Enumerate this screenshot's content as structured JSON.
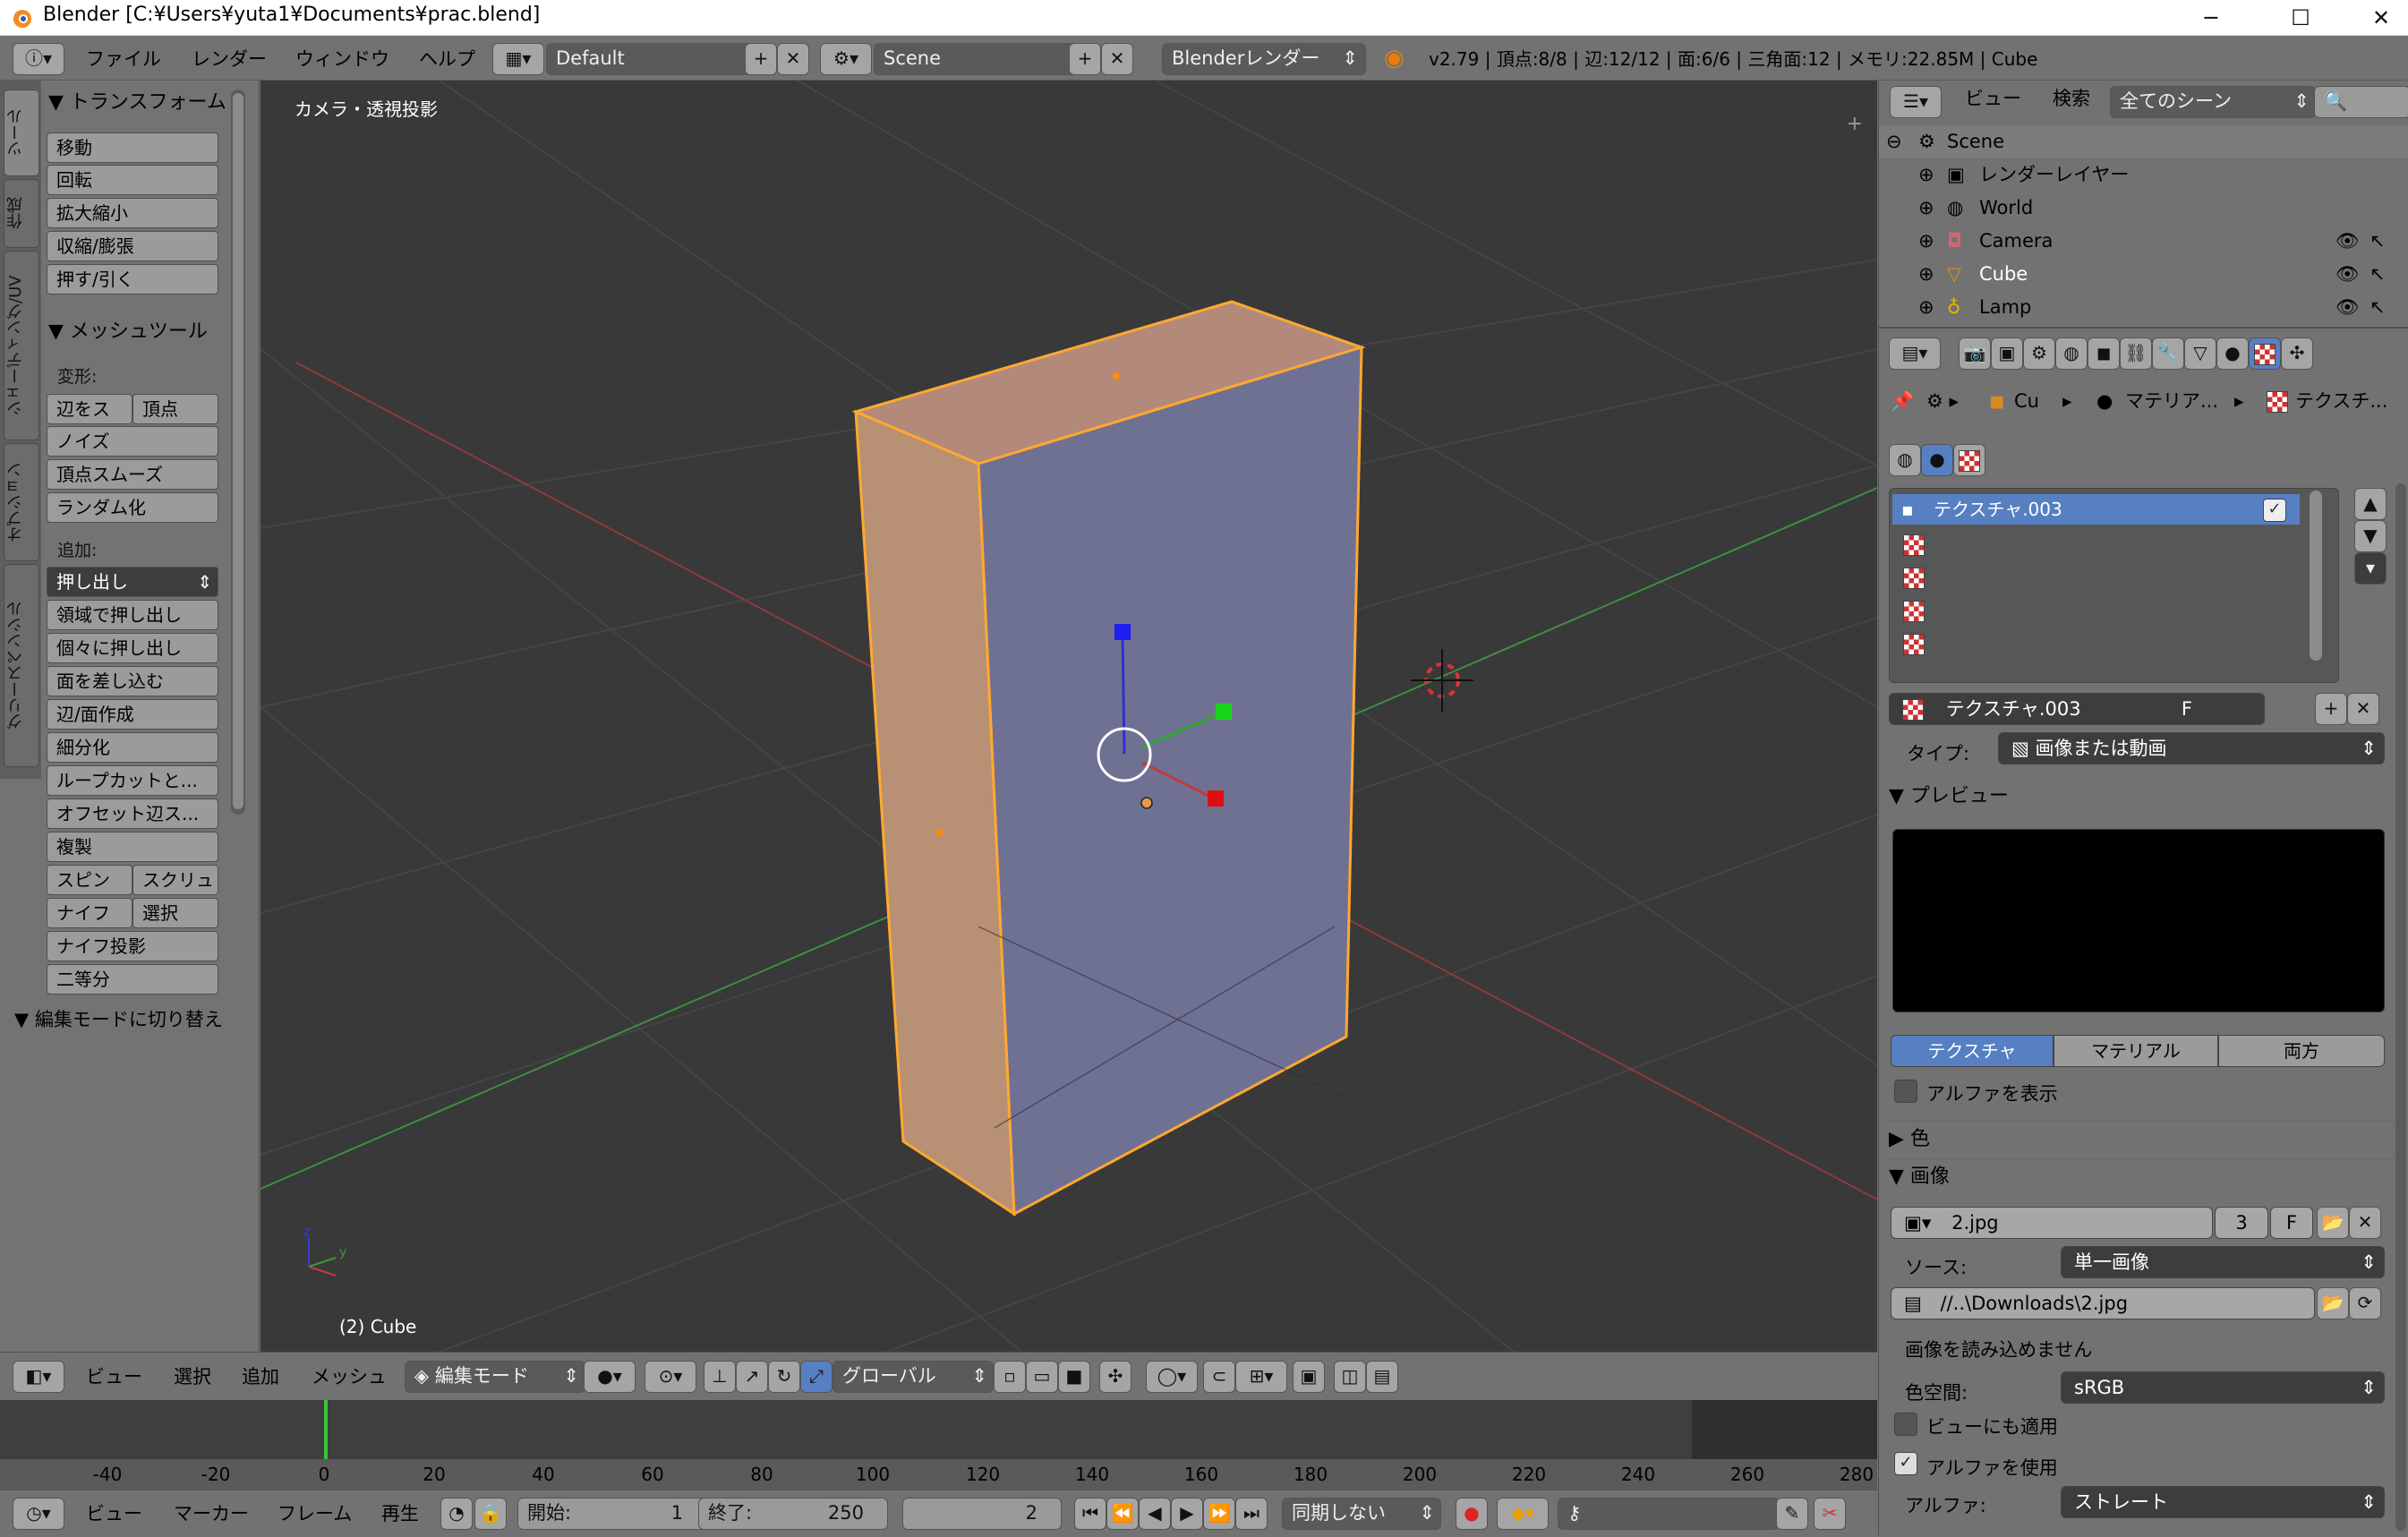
{
  "window": {
    "title": "Blender [C:¥Users¥yuta1¥Documents¥prac.blend]",
    "minimize": "─",
    "maximize": "☐",
    "close": "✕"
  },
  "info_header": {
    "menus": [
      "ファイル",
      "レンダー",
      "ウィンドウ",
      "ヘルプ"
    ],
    "layout_field": "Default",
    "scene_field": "Scene",
    "engine": "Blenderレンダー",
    "stats": "v2.79 | 頂点:8/8 | 辺:12/12 | 面:6/6 | 三角面:12 | メモリ:22.85M | Cube"
  },
  "tool_shelf": {
    "vtabs": [
      "ツール",
      "作成",
      "シェーディング/UV",
      "オプション",
      "グリースペンシル"
    ],
    "transform_head": "▼ トランスフォーム",
    "transform_buttons": [
      "移動",
      "回転",
      "拡大縮小",
      "収縮/膨張",
      "押す/引く"
    ],
    "mesh_head": "▼ メッシュツール",
    "deform_label": "変形:",
    "deform_row": [
      "辺をス",
      "頂点"
    ],
    "deform_buttons": [
      "ノイズ",
      "頂点スムーズ",
      "ランダム化"
    ],
    "add_label": "追加:",
    "extrude_dropdown": "押し出し",
    "add_buttons": [
      "領域で押し出し",
      "個々に押し出し",
      "面を差し込む",
      "辺/面作成",
      "細分化",
      "ループカットと...",
      "オフセット辺ス...",
      "複製"
    ],
    "spin_row": [
      "スピン",
      "スクリュ"
    ],
    "knife_row": [
      "ナイフ",
      "選択"
    ],
    "add_buttons2": [
      "ナイフ投影",
      "二等分"
    ],
    "editmode_head": "▼ 編集モードに切り替え"
  },
  "viewport": {
    "view_label": "カメラ・透視投影",
    "object_label": "(2) Cube"
  },
  "view3d_header": {
    "menus": [
      "ビュー",
      "選択",
      "追加",
      "メッシュ"
    ],
    "mode": "編集モード",
    "orientation": "グローバル"
  },
  "timeline": {
    "ticks": [
      "-40",
      "-20",
      "0",
      "20",
      "40",
      "60",
      "80",
      "100",
      "120",
      "140",
      "160",
      "180",
      "200",
      "220",
      "240",
      "260",
      "280"
    ],
    "menus": [
      "ビュー",
      "マーカー",
      "フレーム",
      "再生"
    ],
    "start_label": "開始:",
    "start_value": "1",
    "end_label": "終了:",
    "end_value": "250",
    "current_frame": "2",
    "sync": "同期しない"
  },
  "outliner": {
    "menus": [
      "ビュー",
      "検索"
    ],
    "filter": "全てのシーン",
    "items": [
      "Scene",
      "レンダーレイヤー",
      "World",
      "Camera",
      "Cube",
      "Lamp"
    ]
  },
  "properties": {
    "breadcrumb": [
      "Cu",
      "マテリア...",
      "テクスチ..."
    ],
    "texture_list_active": "テクスチャ.003",
    "texture_name": "テクスチャ.003",
    "texture_f": "F",
    "type_label": "タイプ:",
    "type_value": "画像または動画",
    "preview_head": "▼ プレビュー",
    "preview_tabs": [
      "テクスチャ",
      "マテリアル",
      "両方"
    ],
    "show_alpha": "アルファを表示",
    "color_head": "▶ 色",
    "image_head": "▼ 画像",
    "image_name": "2.jpg",
    "image_users": "3",
    "image_f": "F",
    "source_label": "ソース:",
    "source_value": "単一画像",
    "filepath": "//..\\Downloads\\2.jpg",
    "load_error": "画像を読み込めません",
    "colorspace_label": "色空間:",
    "colorspace_value": "sRGB",
    "view_as_render": "ビューにも適用",
    "use_alpha": "アルファを使用",
    "alpha_label": "アルファ:",
    "alpha_value": "ストレート"
  },
  "colors": {
    "selected_face": "#5680c2",
    "accent": "#5680c2",
    "edge_orange": "#ffa830"
  }
}
